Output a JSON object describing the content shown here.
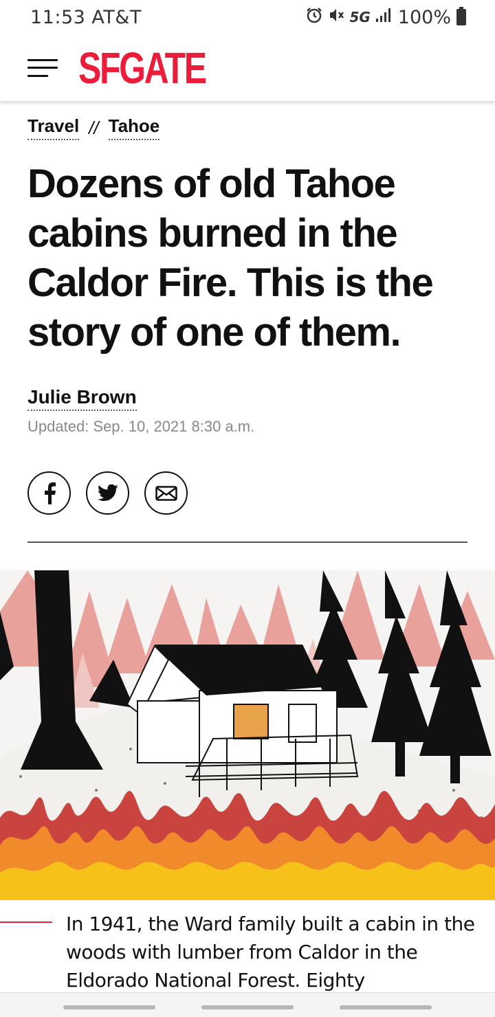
{
  "status": {
    "time_carrier": "11:53 AT&T",
    "network": "5G",
    "battery": "100%"
  },
  "header": {
    "logo": "SFGATE",
    "logo_color": "#ea1d3b"
  },
  "breadcrumb": {
    "items": [
      "Travel",
      "Tahoe"
    ],
    "separator": "//"
  },
  "article": {
    "headline": "Dozens of old Tahoe cabins burned in the Caldor Fire. This is the story of one of them.",
    "author": "Julie Brown",
    "updated": "Updated: Sep. 10, 2021 8:30 a.m.",
    "lead": "In 1941, the Ward family built a cabin in the woods with lumber from Caldor in the Eldorado National Forest. Eighty"
  },
  "share": {
    "icons": [
      "facebook-icon",
      "twitter-icon",
      "email-icon"
    ]
  }
}
